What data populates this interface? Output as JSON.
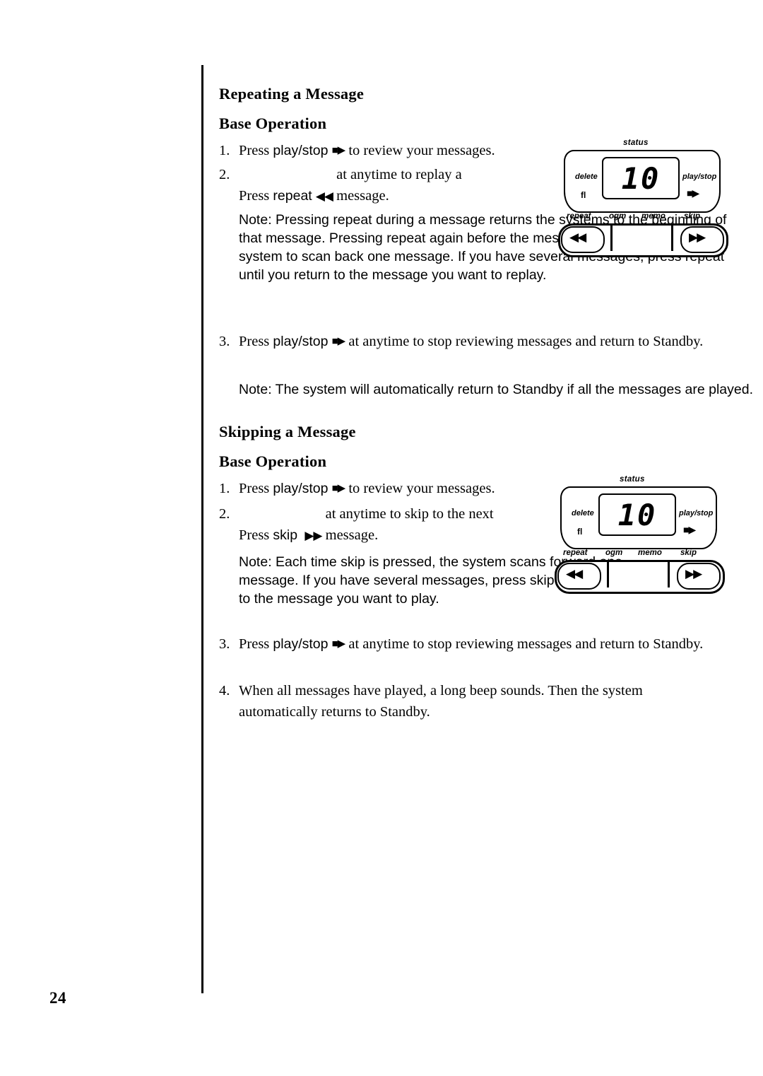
{
  "page": {
    "number": "24"
  },
  "sections": [
    {
      "id": "repeating",
      "title": "Repeating a Message",
      "subtitle": "Base Operation",
      "steps": [
        {
          "num": "1.",
          "pre": "Press ",
          "key": "play/stop",
          "glyph": "■▶",
          "post": " to review your messages."
        },
        {
          "num": "2.",
          "pre": "Press ",
          "key": "repeat",
          "glyph": "◀◀",
          "post": " at anytime to replay a message."
        },
        {
          "num": "3.",
          "pre": "Press ",
          "key": "play/stop",
          "glyph": "■▶",
          "post": " at anytime to stop reviewing messages and return to Standby."
        }
      ],
      "note1": {
        "lead": "Note: Pressing ",
        "kw1": "repeat",
        "mid1": " during a message returns the systems to the beginning of that message. Pressing ",
        "kw2": "repeat",
        "mid2": " again before the message replays causes the system to scan back one message. If you have several messages, press ",
        "kw3": "repeat",
        "tail": " until you return to the message you want to replay."
      },
      "note2": "Note: The system will automatically return to Standby if all the messages are played."
    },
    {
      "id": "skipping",
      "title": "Skipping a Message",
      "subtitle": "Base Operation",
      "steps": [
        {
          "num": "1.",
          "pre": "Press ",
          "key": "play/stop",
          "glyph": "■▶",
          "post": " to review your messages."
        },
        {
          "num": "2.",
          "pre": "Press ",
          "key": "skip",
          "glyph": "▶▶",
          "post": " at anytime to skip to the next message."
        },
        {
          "num": "3.",
          "pre": "Press ",
          "key": "play/stop",
          "glyph": "■▶",
          "post": " at anytime to stop reviewing messages and return to Standby."
        },
        {
          "num": "4.",
          "pre": "",
          "key": "",
          "glyph": "",
          "post": "When all messages have played, a long beep sounds. Then the system automatically returns to Standby."
        }
      ],
      "note1": {
        "lead": "Note: Each time ",
        "kw1": "skip",
        "mid1": " is pressed, the system scans forward one message. If you have several messages, press ",
        "kw2": "skip",
        "mid2": " until you get to the message you want to play.",
        "kw3": "",
        "tail": ""
      }
    }
  ],
  "device": {
    "status_label": "status",
    "display_value": "10",
    "delete_label": "delete",
    "playstop_label": "play/stop",
    "fl_label": "fl",
    "playstop_glyph": "■▶",
    "row_labels": [
      "repeat",
      "ogm",
      "memo",
      "skip"
    ],
    "left_arrows": "◀◀",
    "right_arrows": "▶▶"
  }
}
